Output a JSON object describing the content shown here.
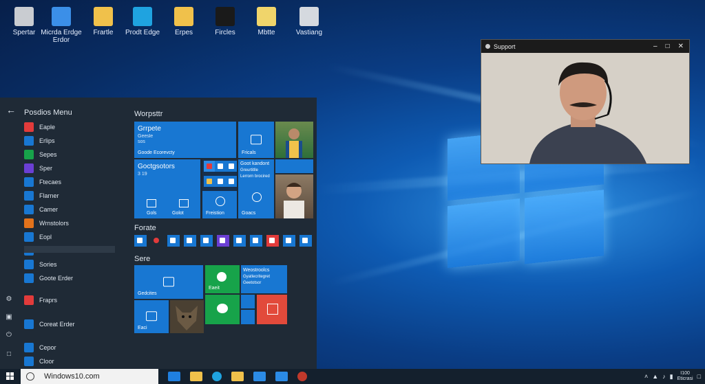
{
  "desktop": {
    "icons": [
      {
        "label": "Spertar",
        "color": "#c9ccd1"
      },
      {
        "label": "Micrda Erdge Erdor",
        "color": "#3b8fe8"
      },
      {
        "label": "Frartle",
        "color": "#f0c14b"
      },
      {
        "label": "Prodt Edge",
        "color": "#1fa3e0"
      },
      {
        "label": "Erpes",
        "color": "#f0c14b"
      },
      {
        "label": "Fircles",
        "color": "#1a1a1a"
      },
      {
        "label": "Mbtte",
        "color": "#f0d56b"
      },
      {
        "label": "Vastiang",
        "color": "#d5d9df"
      }
    ]
  },
  "start_menu": {
    "title": "Posdios Menu",
    "apps": [
      {
        "label": "Eaple",
        "color": "#e23b3b"
      },
      {
        "label": "Erlips",
        "color": "#1877d2"
      },
      {
        "label": "Sepes",
        "color": "#17a34a"
      },
      {
        "label": "Sper",
        "color": "#6b3fd4"
      },
      {
        "label": "Ftecaes",
        "color": "#1877d2"
      },
      {
        "label": "Flarner",
        "color": "#1877d2"
      },
      {
        "label": "Camer",
        "color": "#1877d2"
      },
      {
        "label": "Wrnstolors",
        "color": "#e2721b"
      },
      {
        "label": "Eopl",
        "color": "#1877d2"
      },
      {
        "label": "",
        "color": "#1877d2"
      },
      {
        "label": "Sories",
        "color": "#1877d2"
      },
      {
        "label": "Goote Erder",
        "color": "#1877d2"
      },
      {
        "label": "Fraprs",
        "color": "#e23b3b"
      },
      {
        "label": "Coreat Erder",
        "color": "#1877d2"
      },
      {
        "label": "Cepor",
        "color": "#1877d2"
      },
      {
        "label": "Cloor",
        "color": "#1877d2"
      }
    ],
    "sections": {
      "s1": "Worpsttr",
      "s2": "Forate",
      "s3": "Sere"
    },
    "tiles": {
      "t1_title": "Grrpete",
      "t1_sub": "Geesle",
      "t1_sub2": "sos",
      "t1_bottom": "Goode Ecorevcty",
      "t2_label": "Fricals",
      "t3_title": "Goctgsotors",
      "t3_sub": "3 19",
      "t3_a": "Gols",
      "t3_b": "Golot",
      "t4_label": "Freistion",
      "t5_title": "Goot kandont",
      "t5_sub": "Greurtitlle",
      "t5_sub2": "Lerrorn brocired",
      "t5_label": "Goacs",
      "t6_label": "Gedcites",
      "t7_label": "Eaeit",
      "t8_title": "Weostroolcs",
      "t8_sub": "Gyatlecritegret",
      "t8_sub2": "Geetotsor",
      "t9_label": "Eaci"
    }
  },
  "support_window": {
    "title": "Support",
    "minimize": "–",
    "maximize": "□",
    "close": "✕"
  },
  "taskbar": {
    "search_text": "Windows10.com",
    "tray_time": "I100",
    "tray_date": "Eticrasi"
  }
}
